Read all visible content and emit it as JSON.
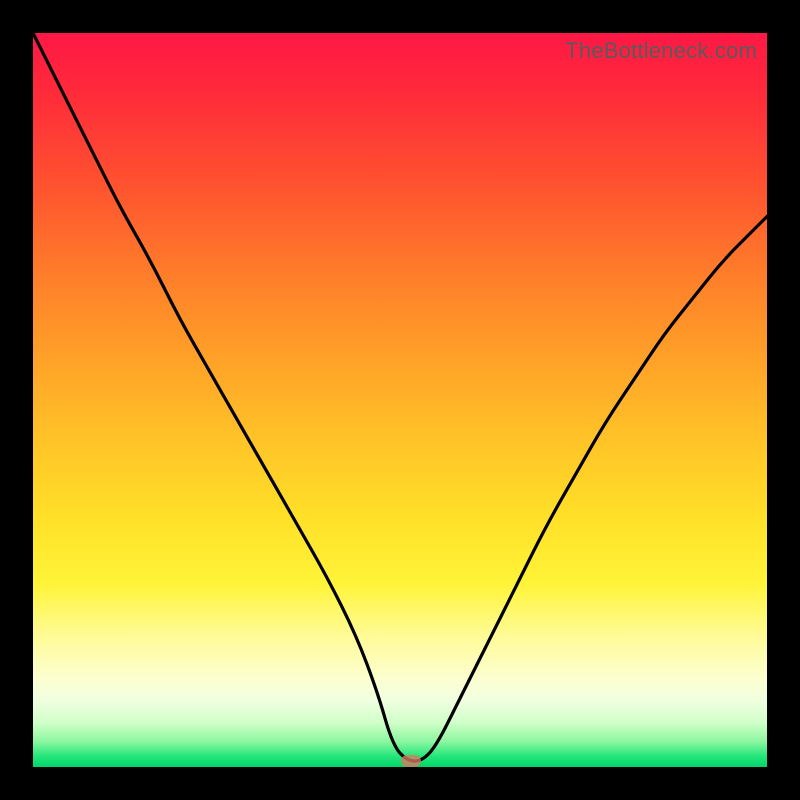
{
  "watermark": "TheBottleneck.com",
  "marker": {
    "x_pct": 51.5,
    "y_pct": 99.2
  },
  "colors": {
    "curve_stroke": "#000000",
    "marker_fill": "rgba(220,120,100,0.78)",
    "frame_bg": "#000000"
  },
  "chart_data": {
    "type": "line",
    "title": "",
    "xlabel": "",
    "ylabel": "",
    "xlim": [
      0,
      100
    ],
    "ylim": [
      0,
      100
    ],
    "series": [
      {
        "name": "bottleneck-curve",
        "x": [
          0,
          4,
          8,
          12,
          16,
          20,
          24,
          28,
          32,
          36,
          40,
          44,
          47,
          49,
          51,
          53,
          55,
          58,
          62,
          66,
          70,
          74,
          78,
          82,
          86,
          90,
          94,
          98,
          100
        ],
        "y": [
          100,
          92,
          84,
          76,
          69,
          61,
          54,
          47,
          40,
          33,
          26,
          18,
          10,
          3,
          0.8,
          0.8,
          3,
          9,
          17,
          25,
          33,
          40,
          47,
          53,
          59,
          64,
          69,
          73,
          75
        ]
      }
    ],
    "annotations": [
      {
        "kind": "marker",
        "x": 51.5,
        "y": 0.8,
        "shape": "rounded-pill"
      }
    ],
    "grid": false,
    "legend": false
  }
}
